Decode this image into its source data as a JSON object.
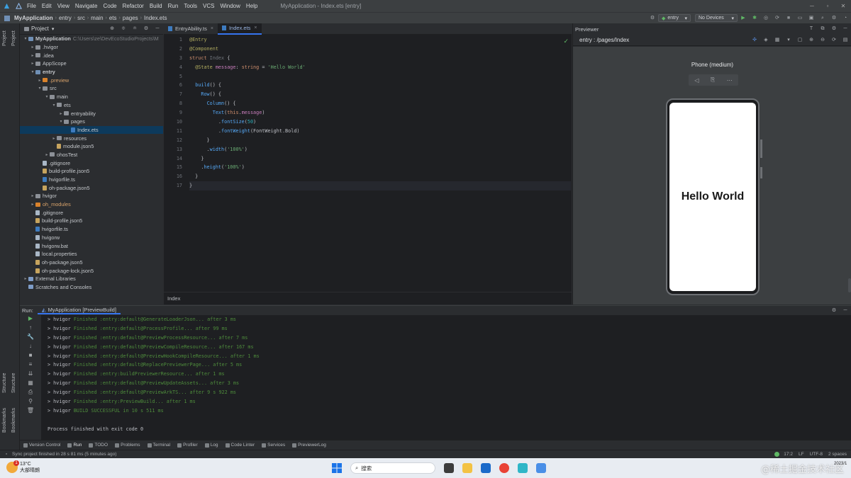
{
  "menubar": {
    "items": [
      "File",
      "Edit",
      "View",
      "Navigate",
      "Code",
      "Refactor",
      "Build",
      "Run",
      "Tools",
      "VCS",
      "Window",
      "Help"
    ],
    "window_title": "MyApplication - Index.ets [entry]",
    "controls": [
      "─",
      "▫",
      "✕"
    ]
  },
  "navbar": {
    "breadcrumb": [
      "MyApplication",
      "entry",
      "src",
      "main",
      "ets",
      "pages",
      "Index.ets"
    ],
    "module_combo": "entry",
    "device_combo": "No Devices"
  },
  "leftstrip": {
    "top_tab": "Project",
    "side_tab2": "Project",
    "structure_tab": "Structure",
    "bookmarks_tab": "Bookmarks"
  },
  "project": {
    "title": "Project",
    "tree": [
      {
        "label": "MyApplication",
        "extra": "C:\\Users\\ze\\DevEcoStudioProjects\\M",
        "indent": 0,
        "arrow": "▾",
        "icon": "folder-b",
        "bold": true
      },
      {
        "label": ".hvigor",
        "indent": 1,
        "arrow": "▸",
        "icon": "folder"
      },
      {
        "label": ".idea",
        "indent": 1,
        "arrow": "▸",
        "icon": "folder"
      },
      {
        "label": "AppScope",
        "indent": 1,
        "arrow": "▸",
        "icon": "folder"
      },
      {
        "label": "entry",
        "indent": 1,
        "arrow": "▾",
        "icon": "folder-b",
        "bold": true
      },
      {
        "label": ".preview",
        "indent": 2,
        "arrow": "▸",
        "icon": "folder-o",
        "orange": true
      },
      {
        "label": "src",
        "indent": 2,
        "arrow": "▾",
        "icon": "folder"
      },
      {
        "label": "main",
        "indent": 3,
        "arrow": "▾",
        "icon": "folder"
      },
      {
        "label": "ets",
        "indent": 4,
        "arrow": "▾",
        "icon": "folder"
      },
      {
        "label": "entryability",
        "indent": 5,
        "arrow": "▸",
        "icon": "folder"
      },
      {
        "label": "pages",
        "indent": 5,
        "arrow": "▾",
        "icon": "folder"
      },
      {
        "label": "Index.ets",
        "indent": 6,
        "arrow": "",
        "icon": "ts",
        "selected": true
      },
      {
        "label": "resources",
        "indent": 4,
        "arrow": "▸",
        "icon": "folder"
      },
      {
        "label": "module.json5",
        "indent": 4,
        "arrow": "",
        "icon": "json"
      },
      {
        "label": "ohosTest",
        "indent": 3,
        "arrow": "▸",
        "icon": "folder"
      },
      {
        "label": ".gitignore",
        "indent": 2,
        "arrow": "",
        "icon": "file"
      },
      {
        "label": "build-profile.json5",
        "indent": 2,
        "arrow": "",
        "icon": "json"
      },
      {
        "label": "hvigorfile.ts",
        "indent": 2,
        "arrow": "",
        "icon": "ts"
      },
      {
        "label": "oh-package.json5",
        "indent": 2,
        "arrow": "",
        "icon": "json"
      },
      {
        "label": "hvigor",
        "indent": 1,
        "arrow": "▸",
        "icon": "folder"
      },
      {
        "label": "oh_modules",
        "indent": 1,
        "arrow": "▸",
        "icon": "folder-o",
        "orange": true
      },
      {
        "label": ".gitignore",
        "indent": 1,
        "arrow": "",
        "icon": "file"
      },
      {
        "label": "build-profile.json5",
        "indent": 1,
        "arrow": "",
        "icon": "json"
      },
      {
        "label": "hvigorfile.ts",
        "indent": 1,
        "arrow": "",
        "icon": "ts"
      },
      {
        "label": "hvigorw",
        "indent": 1,
        "arrow": "",
        "icon": "file"
      },
      {
        "label": "hvigorw.bat",
        "indent": 1,
        "arrow": "",
        "icon": "file"
      },
      {
        "label": "local.properties",
        "indent": 1,
        "arrow": "",
        "icon": "file"
      },
      {
        "label": "oh-package.json5",
        "indent": 1,
        "arrow": "",
        "icon": "json"
      },
      {
        "label": "oh-package-lock.json5",
        "indent": 1,
        "arrow": "",
        "icon": "json"
      },
      {
        "label": "External Libraries",
        "indent": 0,
        "arrow": "▸",
        "icon": "lib"
      },
      {
        "label": "Scratches and Consoles",
        "indent": 0,
        "arrow": "",
        "icon": "lib"
      }
    ]
  },
  "editor": {
    "tabs": [
      {
        "label": "EntryAbility.ts",
        "active": false
      },
      {
        "label": "Index.ets",
        "active": true
      }
    ],
    "breadcrumb_footer": "Index",
    "code": [
      [
        [
          "dec",
          "@Entry"
        ]
      ],
      [
        [
          "dec",
          "@Component"
        ]
      ],
      [
        [
          "kw",
          "struct "
        ],
        [
          "dim2",
          "Index "
        ],
        [
          "",
          "{"
        ]
      ],
      [
        [
          "",
          "  "
        ],
        [
          "dec",
          "@State "
        ],
        [
          "prop",
          "message"
        ],
        [
          "",
          ": "
        ],
        [
          "kw",
          "string"
        ],
        [
          "",
          " = "
        ],
        [
          "str",
          "'Hello World'"
        ]
      ],
      [
        [
          "",
          ""
        ]
      ],
      [
        [
          "",
          "  "
        ],
        [
          "fn",
          "build"
        ],
        [
          "",
          "() {"
        ]
      ],
      [
        [
          "",
          "    "
        ],
        [
          "fn",
          "Row"
        ],
        [
          "",
          "() {"
        ]
      ],
      [
        [
          "",
          "      "
        ],
        [
          "fn",
          "Column"
        ],
        [
          "",
          "() {"
        ]
      ],
      [
        [
          "",
          "        "
        ],
        [
          "fn",
          "Text"
        ],
        [
          "",
          "("
        ],
        [
          "kw",
          "this"
        ],
        [
          "",
          "."
        ],
        [
          "prop",
          "message"
        ],
        [
          "",
          ")"
        ]
      ],
      [
        [
          "",
          "          ."
        ],
        [
          "fn",
          "fontSize"
        ],
        [
          "",
          "("
        ],
        [
          "num",
          "50"
        ],
        [
          "",
          ")"
        ]
      ],
      [
        [
          "",
          "          ."
        ],
        [
          "fn",
          "fontWeight"
        ],
        [
          "",
          "(FontWeight.Bold)"
        ]
      ],
      [
        [
          "",
          "      }"
        ]
      ],
      [
        [
          "",
          "      ."
        ],
        [
          "fn",
          "width"
        ],
        [
          "",
          "("
        ],
        [
          "str",
          "'100%'"
        ],
        [
          "",
          ")"
        ]
      ],
      [
        [
          "",
          "    }"
        ]
      ],
      [
        [
          "",
          "    ."
        ],
        [
          "fn",
          "height"
        ],
        [
          "",
          "("
        ],
        [
          "str",
          "'100%'"
        ],
        [
          "",
          ")"
        ]
      ],
      [
        [
          "",
          "  }"
        ]
      ],
      [
        [
          "",
          "}"
        ]
      ]
    ]
  },
  "previewer": {
    "title": "Previewer",
    "route": "entry : /pages/Index",
    "device_name": "Phone (medium)",
    "screen_text": "Hello World"
  },
  "run": {
    "label": "Run:",
    "tab": "MyApplication [PreviewBuild]",
    "lines": [
      [
        "> hvigor ",
        "Finished :entry:default@GenerateLoaderJson... after 3 ms"
      ],
      [
        "> hvigor ",
        "Finished :entry:default@ProcessProfile... after 99 ms"
      ],
      [
        "> hvigor ",
        "Finished :entry:default@PreviewProcessResource... after 7 ms"
      ],
      [
        "> hvigor ",
        "Finished :entry:default@PreviewCompileResource... after 167 ms"
      ],
      [
        "> hvigor ",
        "Finished :entry:default@PreviewHookCompileResource... after 1 ms"
      ],
      [
        "> hvigor ",
        "Finished :entry:default@ReplacePreviewerPage... after 5 ms"
      ],
      [
        "> hvigor ",
        "Finished :entry:buildPreviewerResource... after 1 ms"
      ],
      [
        "> hvigor ",
        "Finished :entry:default@PreviewUpdateAssets... after 3 ms"
      ],
      [
        "> hvigor ",
        "Finished :entry:default@PreviewArkTS... after 9 s 922 ms"
      ],
      [
        "> hvigor ",
        "Finished :entry:PreviewBuild... after 1 ms"
      ],
      [
        "> hvigor ",
        "BUILD SUCCESSFUL in 10 s 511 ms"
      ],
      [
        "",
        ""
      ],
      [
        "Process finished with exit code 0",
        ""
      ]
    ]
  },
  "tooltabs": [
    "Version Control",
    "Run",
    "TODO",
    "Problems",
    "Terminal",
    "Profiler",
    "Log",
    "Code Linter",
    "Services",
    "PreviewerLog"
  ],
  "statusbar": {
    "message": "Sync project finished in 28 s 81 ms (5 minutes ago)",
    "position": "17:2",
    "line_sep": "LF",
    "encoding": "UTF-8",
    "indent": "2 spaces"
  },
  "taskbar": {
    "temperature": "13°C",
    "weather": "大部晴朗",
    "search_placeholder": "搜索",
    "clock_date": "2023/1"
  },
  "watermark": "@稀土掘金技术社区",
  "colors": {
    "accent": "#3574f0",
    "run_green": "#4e8c3c",
    "selection": "#0d3a5c"
  }
}
